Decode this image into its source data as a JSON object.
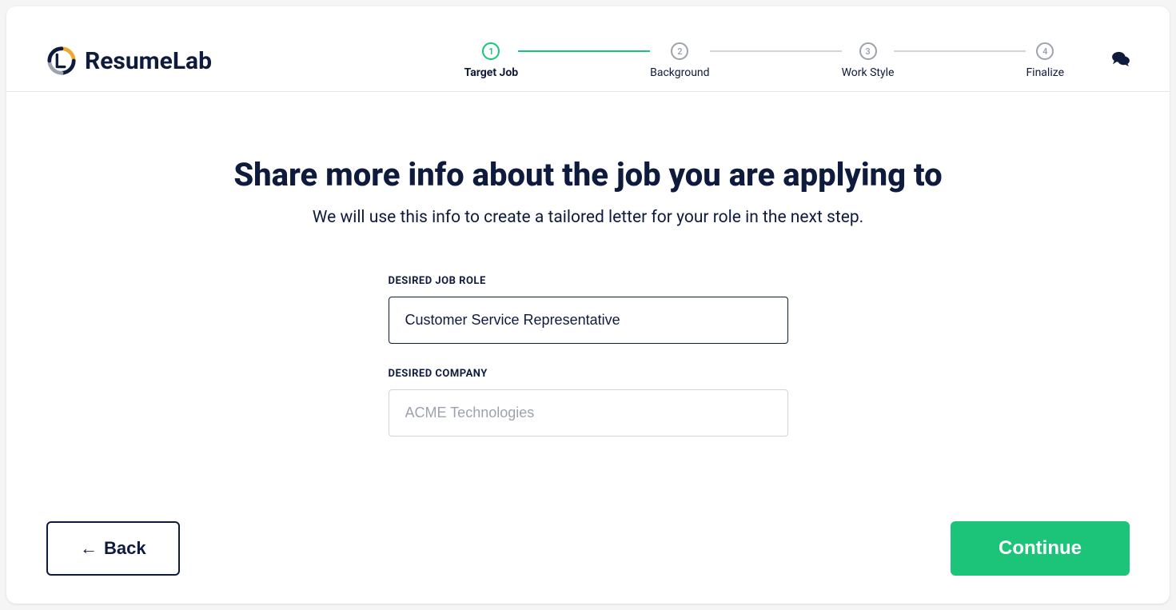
{
  "logo": {
    "text": "ResumeLab"
  },
  "stepper": {
    "steps": [
      {
        "number": "1",
        "label": "Target Job"
      },
      {
        "number": "2",
        "label": "Background"
      },
      {
        "number": "3",
        "label": "Work Style"
      },
      {
        "number": "4",
        "label": "Finalize"
      }
    ]
  },
  "content": {
    "title": "Share more info about the job you are applying to",
    "subtitle": "We will use this info to create a tailored letter for your role in the next step."
  },
  "form": {
    "job_role": {
      "label": "DESIRED JOB ROLE",
      "value": "Customer Service Representative"
    },
    "company": {
      "label": "DESIRED COMPANY",
      "placeholder": "ACME Technologies"
    }
  },
  "footer": {
    "back_label": "Back",
    "continue_label": "Continue"
  }
}
